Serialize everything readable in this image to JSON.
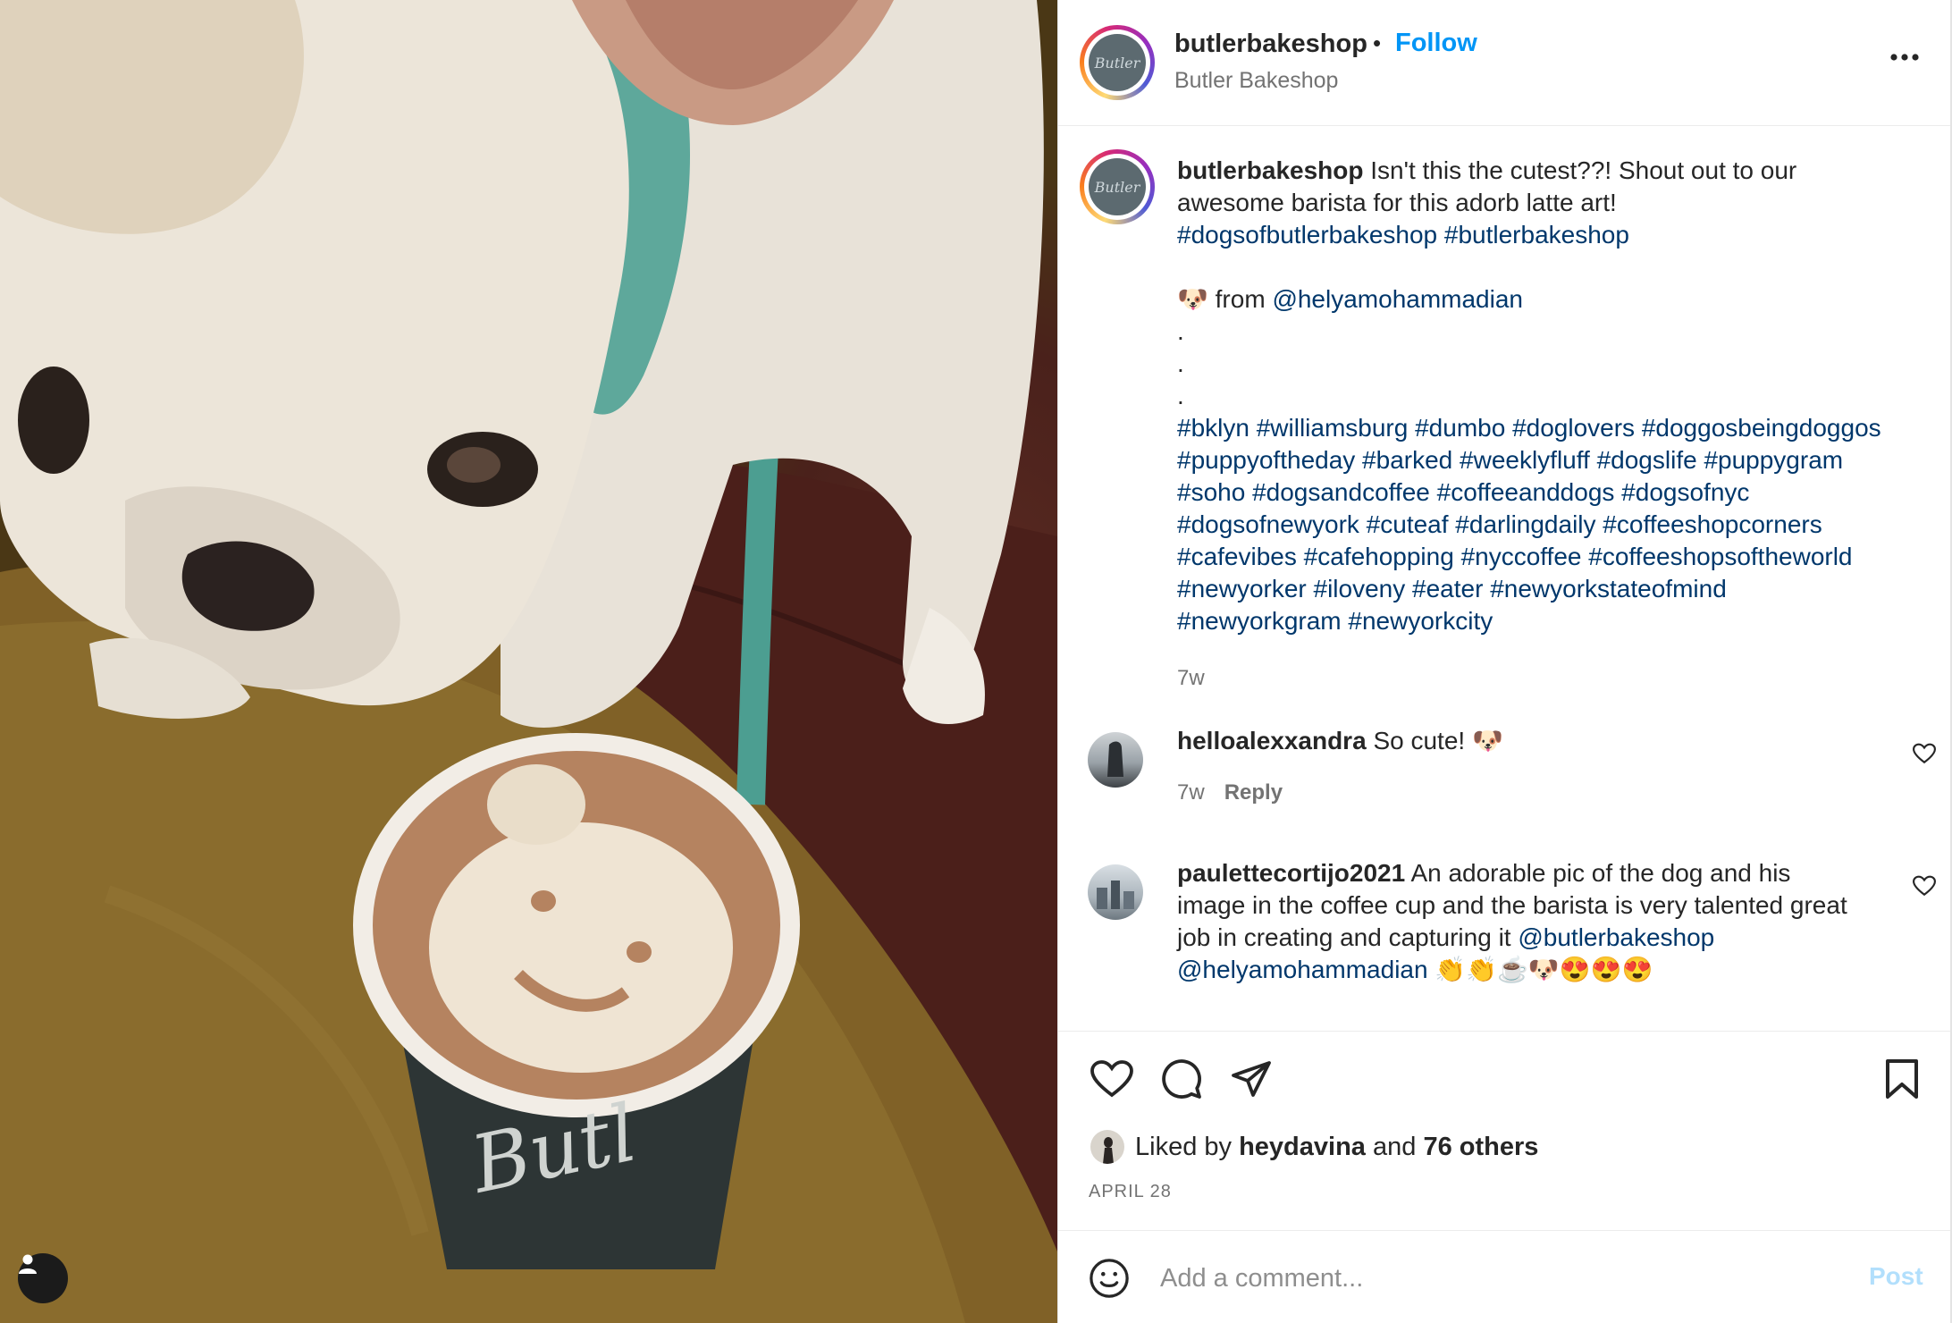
{
  "post": {
    "username": "butlerbakeshop",
    "follow_label": "Follow",
    "dot": "•",
    "subtitle": "Butler Bakeshop",
    "avatar_text": "Butler",
    "photo_cup_text": "Butl"
  },
  "caption": {
    "username": "butlerbakeshop",
    "text": "Isn't this the cutest??! Shout out to our awesome barista for this adorb latte art!",
    "hashtags_1": "#dogsofbutlerbakeshop #butlerbakeshop",
    "from_emoji": "🐶",
    "from_label": "from",
    "from_mention": "@helyamohammadian",
    "dot": ".",
    "hashtags_2": "#bklyn #williamsburg #dumbo #doglovers #doggosbeingdoggos #puppyoftheday #barked #weeklyfluff #dogslife #puppygram #soho #dogsandcoffee #coffeeanddogs #dogsofnyc #dogsofnewyork #cuteaf #darlingdaily #coffeeshopcorners #cafevibes #cafehopping #nyccoffee #coffeeshopsoftheworld #newyorker #iloveny #eater #newyorkstateofmind #newyorkgram #newyorkcity",
    "time": "7w"
  },
  "comments": [
    {
      "username": "helloalexxandra",
      "text": "So cute! 🐶",
      "time": "7w",
      "reply_label": "Reply"
    },
    {
      "username": "paulettecortijo2021",
      "text": "An adorable pic of the dog and his image in the coffee cup and the barista is very talented great job in creating and capturing it",
      "mention_1": "@butlerbakeshop",
      "mention_2": "@helyamohammadian",
      "emojis": "👏👏☕🐶😍😍😍"
    }
  ],
  "likes": {
    "prefix": "Liked by",
    "user": "heydavina",
    "and": "and",
    "others": "76 others"
  },
  "date": "APRIL 28",
  "comment_box": {
    "placeholder": "Add a comment...",
    "post_label": "Post"
  },
  "icons": {
    "more": "more-horizontal-icon",
    "like": "heart-icon",
    "comment": "comment-bubble-icon",
    "share": "paper-plane-icon",
    "save": "bookmark-icon",
    "emoji": "emoji-smile-icon",
    "user_tag": "user-tag-icon"
  },
  "colors": {
    "link": "#00376b",
    "follow": "#0095f6",
    "muted": "#737373",
    "post_disabled": "#b2dffc"
  }
}
